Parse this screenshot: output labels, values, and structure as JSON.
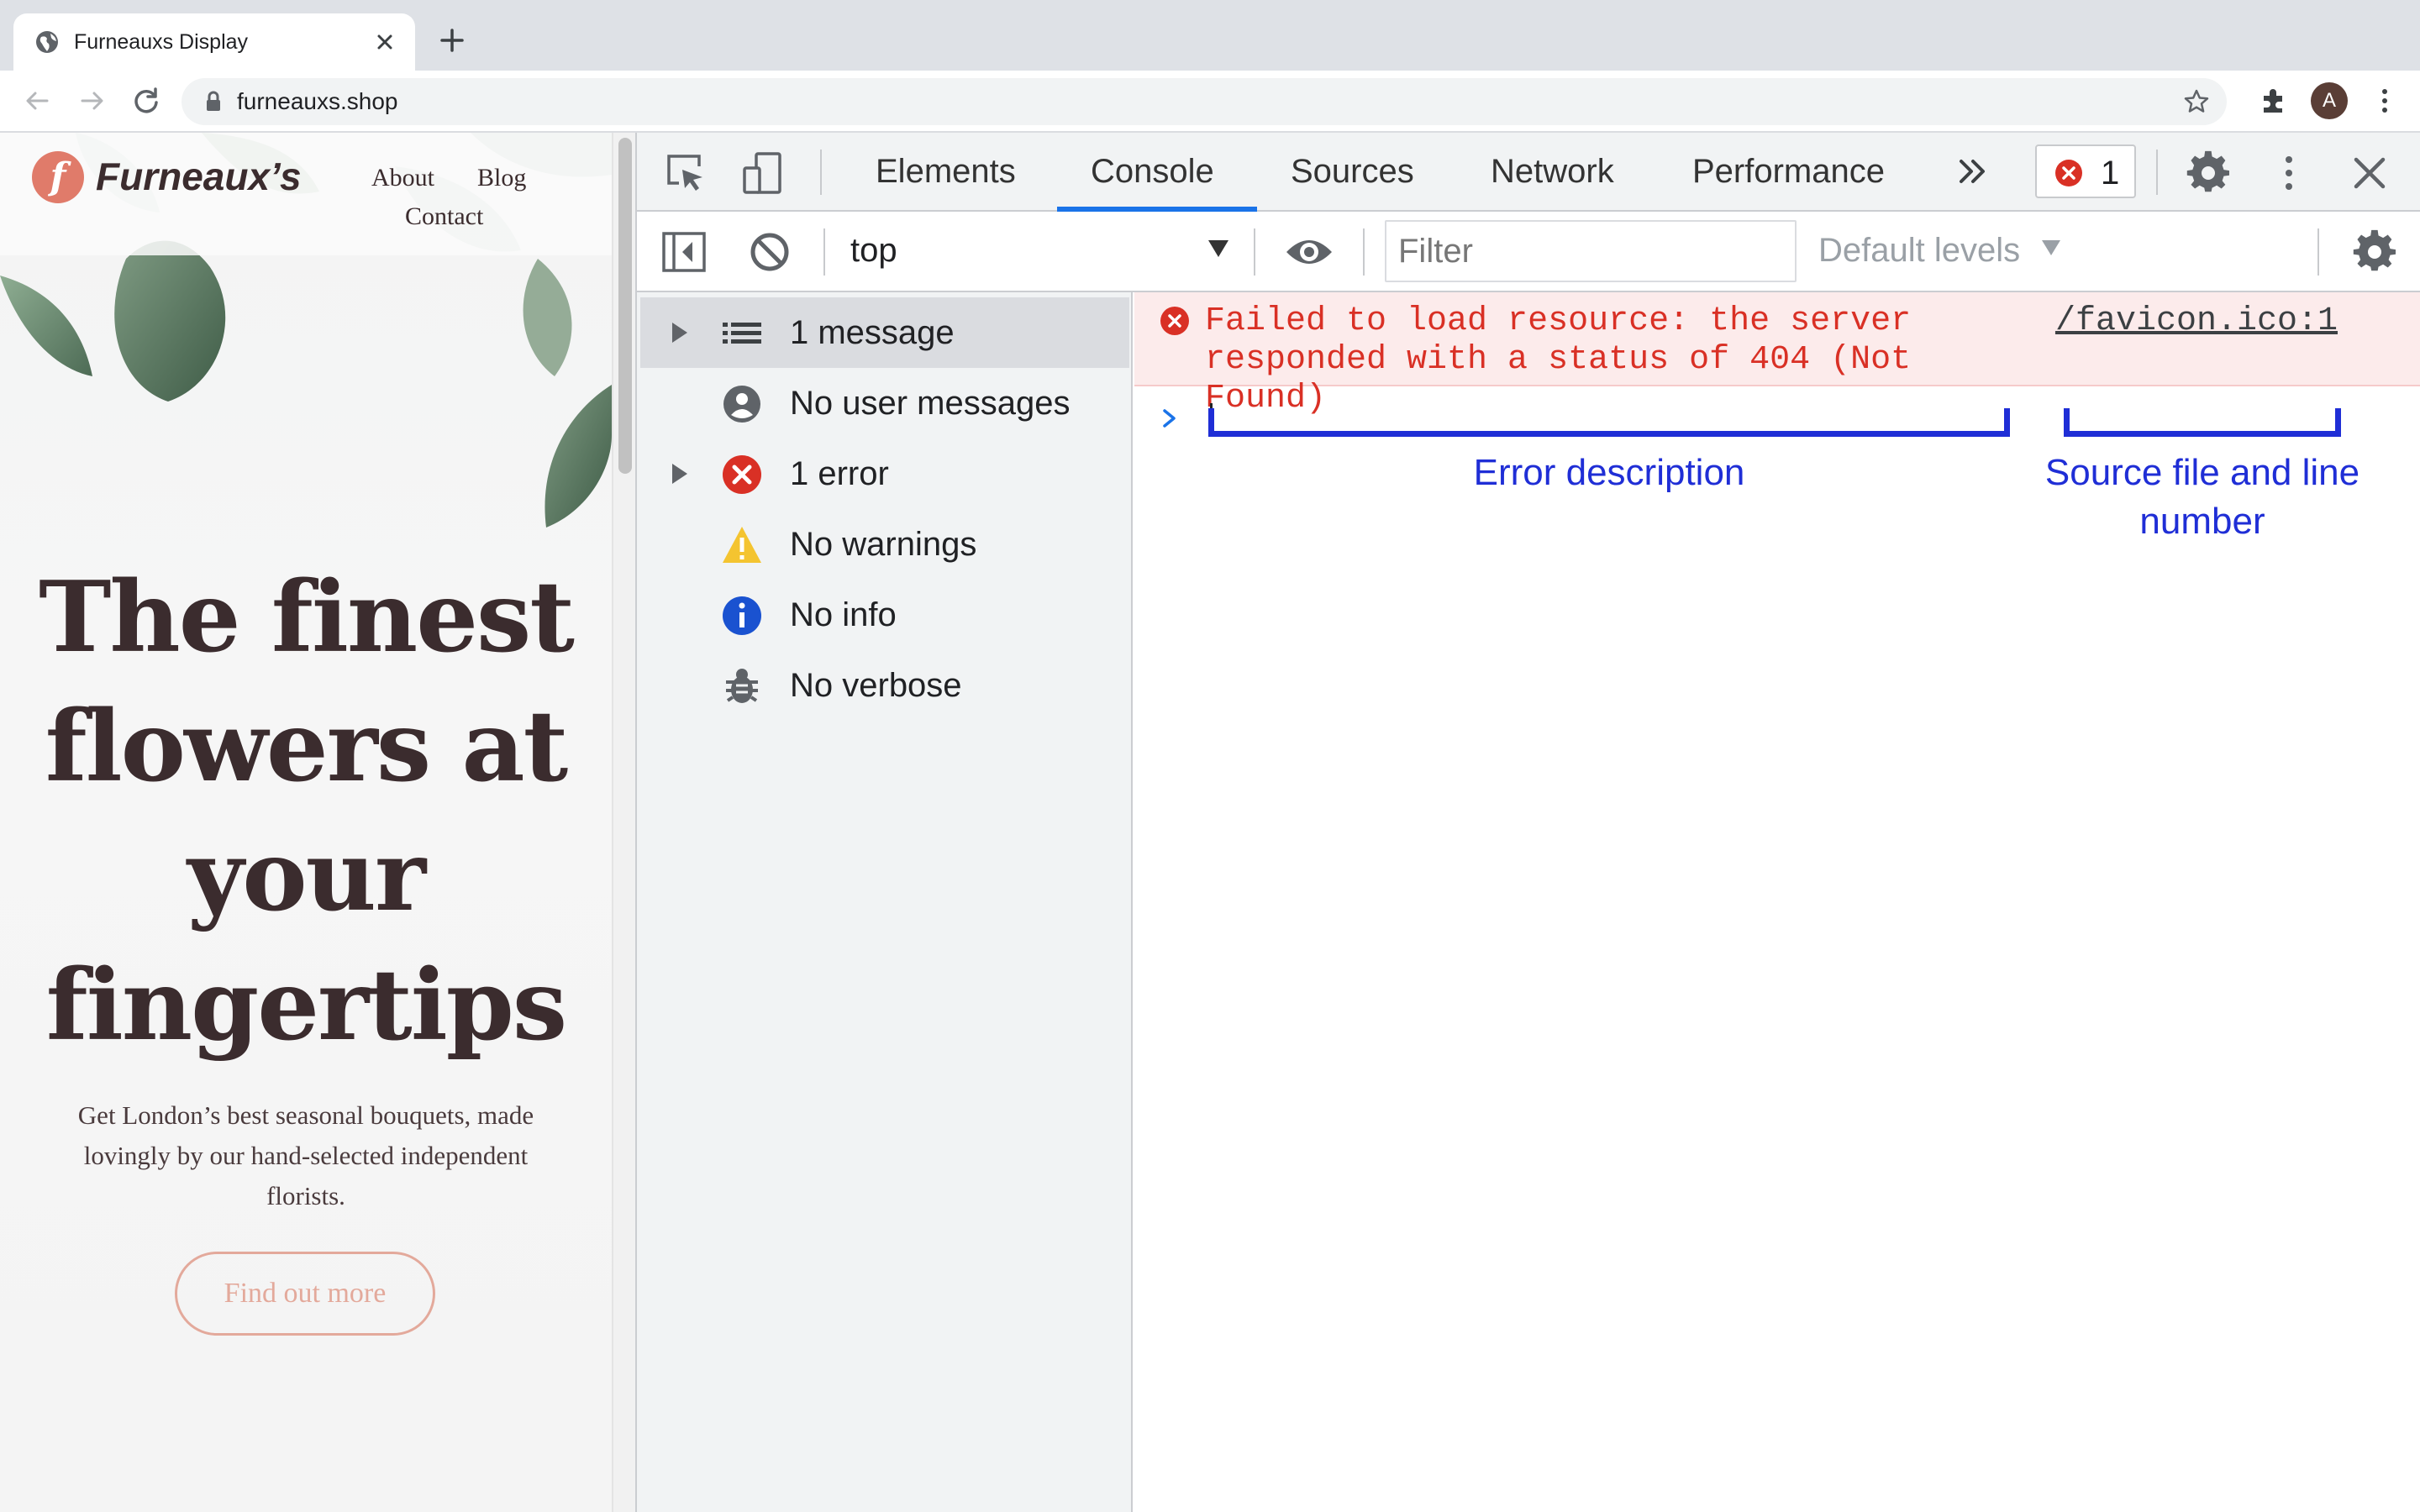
{
  "browser": {
    "tab_title": "Furneauxs Display",
    "url": "furneauxs.shop",
    "avatar_initial": "A"
  },
  "site": {
    "logo_mark": "f",
    "logo_text": "Furneaux’s",
    "nav": {
      "about": "About",
      "blog": "Blog",
      "contact": "Contact"
    },
    "hero_title": "The finest flowers at your fingertips",
    "hero_subtitle": "Get London’s best seasonal bouquets, made lovingly by our hand-selected independent florists.",
    "cta_label": "Find out more"
  },
  "devtools": {
    "tabs": {
      "elements": "Elements",
      "console": "Console",
      "sources": "Sources",
      "network": "Network",
      "performance": "Performance"
    },
    "error_badge_count": "1",
    "context": "top",
    "filter_placeholder": "Filter",
    "levels": "Default levels",
    "sidebar": {
      "messages": "1 message",
      "user_messages": "No user messages",
      "errors": "1 error",
      "warnings": "No warnings",
      "info": "No info",
      "verbose": "No verbose"
    },
    "console": {
      "error_message": "Failed to load resource: the server responded with a status of 404 (Not Found)",
      "error_source": "/favicon.ico:1"
    },
    "annotations": {
      "description": "Error description",
      "source": "Source file and line number"
    }
  },
  "colors": {
    "accent": "#1a73e8",
    "error_red": "#d93025",
    "annotation_blue": "#1f2ed6",
    "brand_coral": "#e07b6a",
    "cta_pink": "#e3a99b"
  }
}
